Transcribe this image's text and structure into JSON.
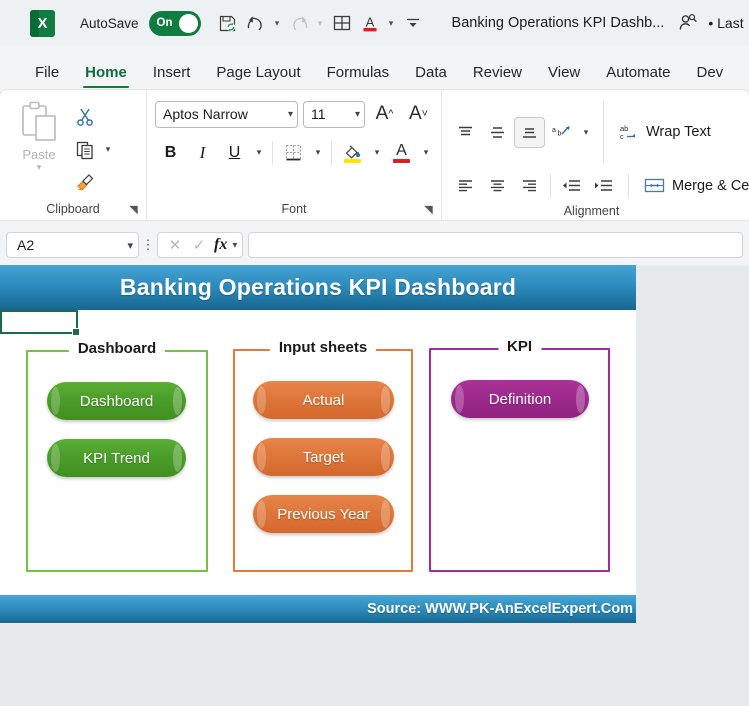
{
  "titlebar": {
    "app_icon": "excel-logo",
    "app_letter": "X",
    "autosave_label": "AutoSave",
    "autosave_state": "On",
    "document_title": "Banking Operations KPI Dashb...",
    "last_modified": "• Last",
    "quick_access": [
      {
        "name": "save-icon",
        "label": "Save"
      },
      {
        "name": "undo-icon",
        "label": "Undo"
      },
      {
        "name": "redo-icon",
        "label": "Redo"
      },
      {
        "name": "table-icon",
        "label": "Table"
      },
      {
        "name": "font-color-icon",
        "label": "Font Color"
      },
      {
        "name": "customize-qat-icon",
        "label": "Customize Quick Access Toolbar"
      }
    ]
  },
  "ribbon": {
    "tabs": [
      {
        "label": "File",
        "active": false
      },
      {
        "label": "Home",
        "active": true
      },
      {
        "label": "Insert",
        "active": false
      },
      {
        "label": "Page Layout",
        "active": false
      },
      {
        "label": "Formulas",
        "active": false
      },
      {
        "label": "Data",
        "active": false
      },
      {
        "label": "Review",
        "active": false
      },
      {
        "label": "View",
        "active": false
      },
      {
        "label": "Automate",
        "active": false
      },
      {
        "label": "Dev",
        "active": false
      }
    ],
    "clipboard": {
      "group_label": "Clipboard",
      "paste_label": "Paste",
      "cut_label": "Cut",
      "copy_label": "Copy",
      "format_painter_label": "Format Painter"
    },
    "font": {
      "group_label": "Font",
      "font_name": "Aptos Narrow",
      "font_size": "11",
      "grow_label": "A",
      "shrink_label": "A",
      "bold_label": "B",
      "italic_label": "I",
      "underline_label": "U",
      "borders_label": "Borders",
      "fill_color_label": "Fill Color",
      "font_color_label": "A",
      "fill_color_hex": "#ffe600",
      "font_color_hex": "#e01b24"
    },
    "alignment": {
      "group_label": "Alignment",
      "wrap_text_label": "Wrap Text",
      "merge_center_label": "Merge & Cent",
      "top_align_label": "Top Align",
      "middle_align_label": "Middle Align",
      "bottom_align_label": "Bottom Align",
      "orientation_label": "Orientation",
      "align_left_label": "Align Left",
      "center_label": "Center",
      "align_right_label": "Align Right",
      "decrease_indent_label": "Decrease Indent",
      "increase_indent_label": "Increase Indent"
    }
  },
  "formula_bar": {
    "name_box": "A2",
    "cancel_label": "Cancel",
    "enter_label": "Enter",
    "fx_label": "fx",
    "formula_value": ""
  },
  "dashboard": {
    "title": "Banking Operations KPI Dashboard",
    "source": "Source: WWW.PK-AnExcelExpert.Com",
    "sections": [
      {
        "label": "Dashboard",
        "color": "#76c043",
        "buttons": [
          {
            "label": "Dashboard"
          },
          {
            "label": "KPI Trend"
          }
        ]
      },
      {
        "label": "Input sheets",
        "color": "#e07b39",
        "buttons": [
          {
            "label": "Actual"
          },
          {
            "label": "Target"
          },
          {
            "label": "Previous Year"
          }
        ]
      },
      {
        "label": "KPI",
        "color": "#a52a9e",
        "buttons": [
          {
            "label": "Definition"
          }
        ]
      }
    ]
  }
}
